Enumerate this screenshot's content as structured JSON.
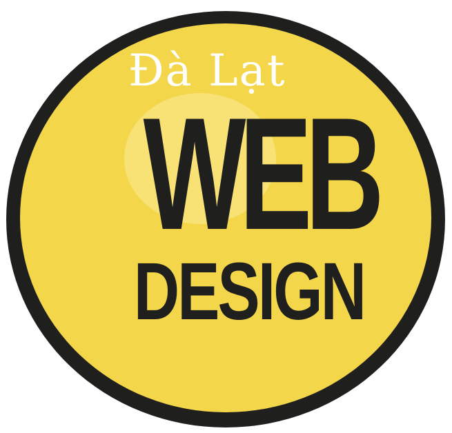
{
  "logo": {
    "top_text": "Đà Lạt",
    "line1": "WEB",
    "line2": "DESIGN"
  },
  "colors": {
    "badge_fill": "#f4d64a",
    "badge_border": "#1f1f1d",
    "text_dark": "#1f1f1d",
    "text_light": "#ffffff"
  }
}
